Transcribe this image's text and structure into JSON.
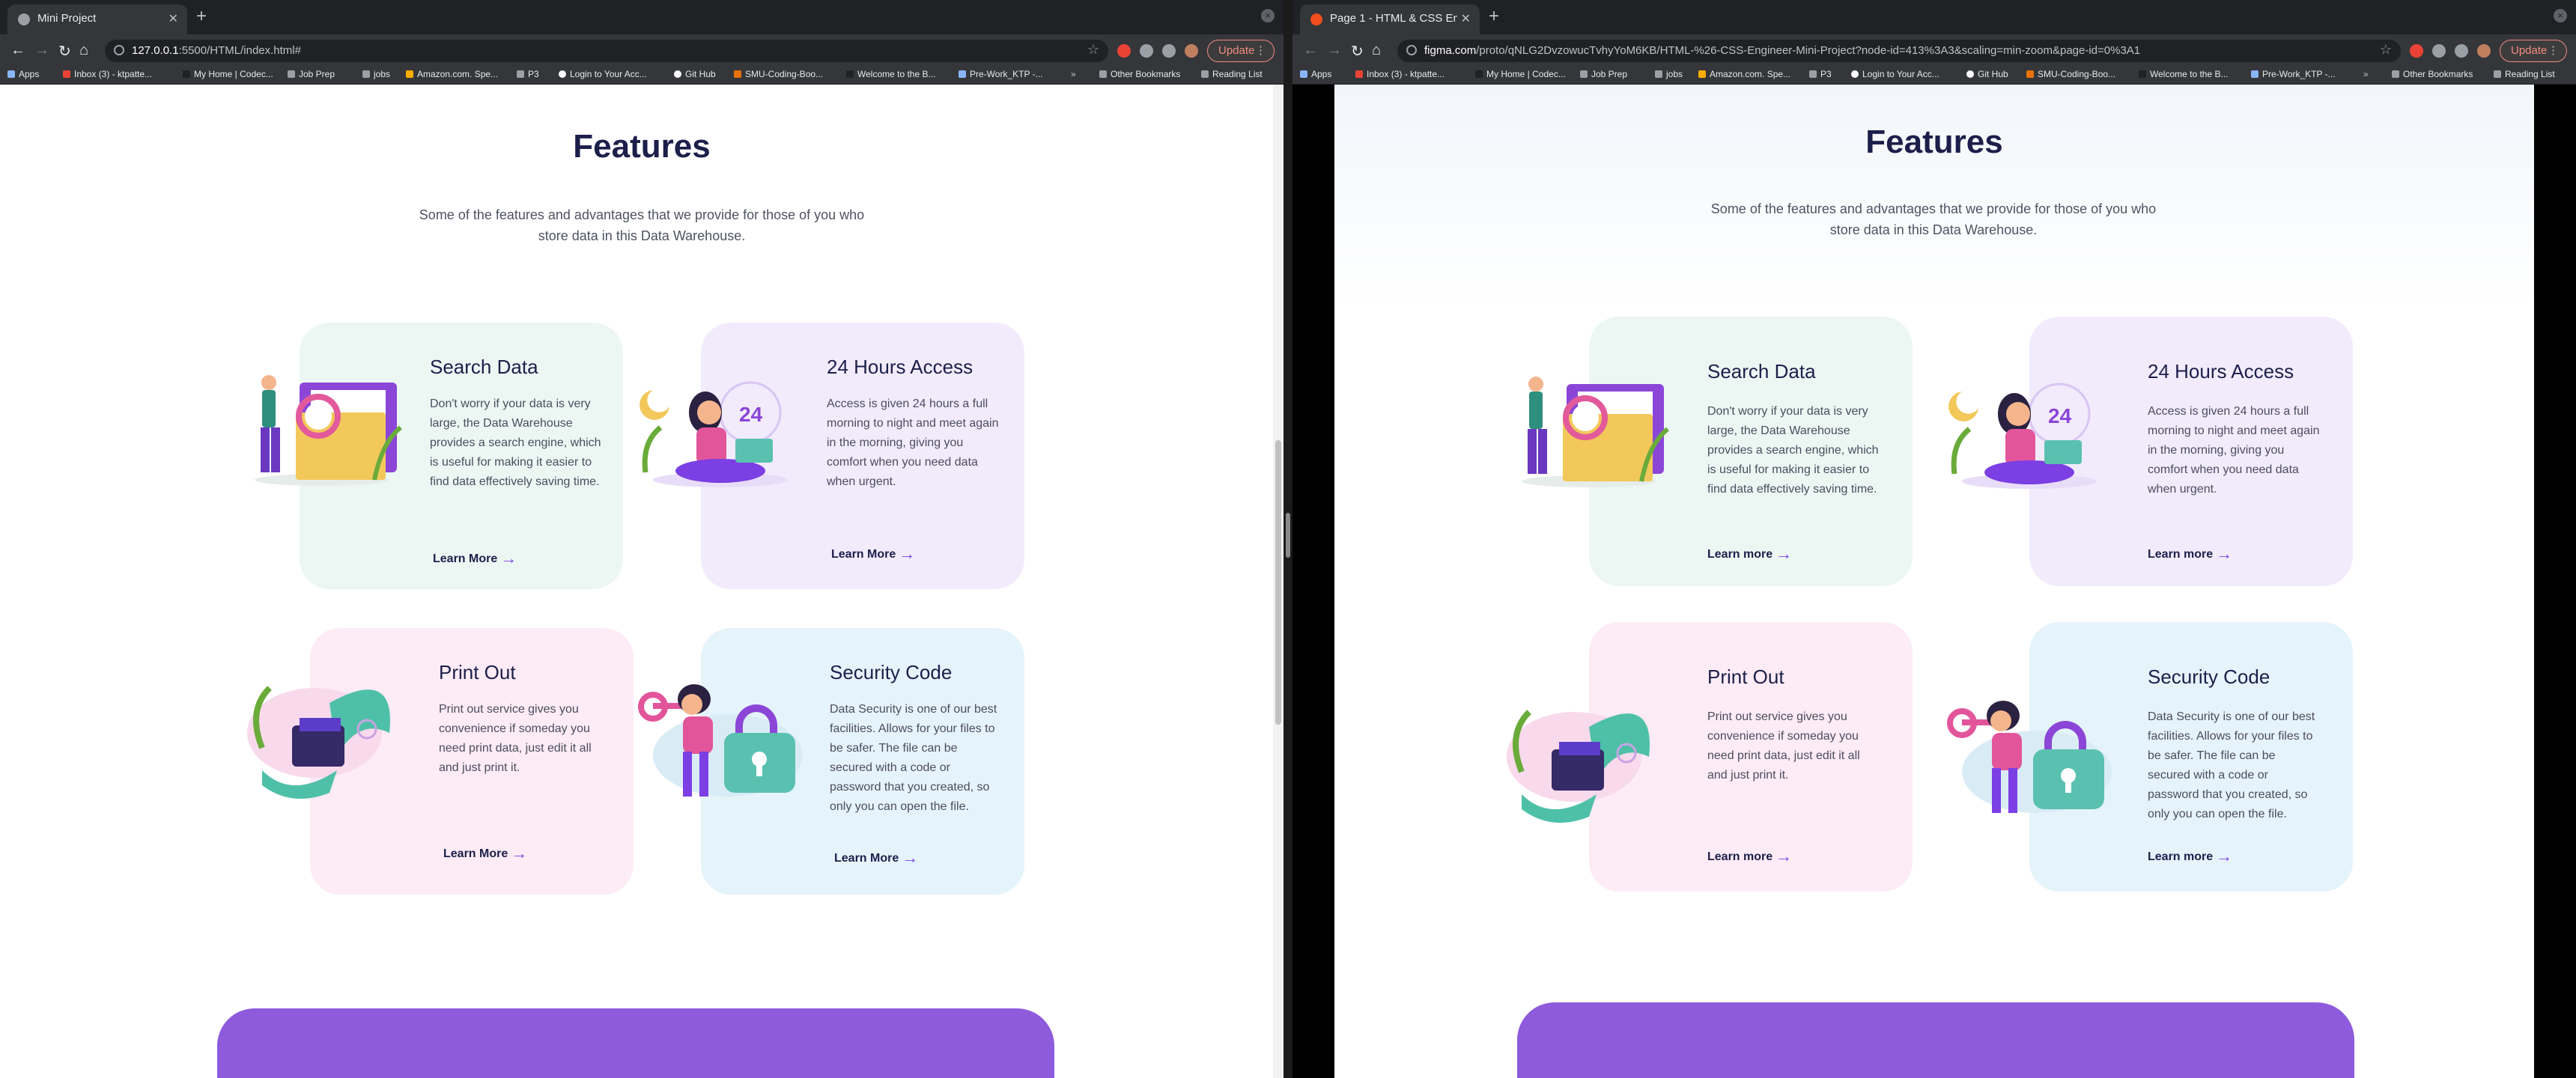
{
  "left": {
    "tab_title": "Mini Project",
    "url_host": "127.0.0.1",
    "url_rest": ":5500/HTML/index.html#",
    "update_label": "Update",
    "page": {
      "heading": "Features",
      "subtitle": "Some of the features and advantages that we provide for those of you who store data in this Data Warehouse."
    }
  },
  "right": {
    "tab_title": "Page 1 - HTML & CSS Engi",
    "url_host": "figma.com",
    "url_rest": "/proto/qNLG2DvzowucTvhyYoM6KB/HTML-%26-CSS-Engineer-Mini-Project?node-id=413%3A3&scaling=min-zoom&page-id=0%3A1",
    "update_label": "Update",
    "page": {
      "heading": "Features",
      "subtitle": "Some of the features and advantages that we provide for those of you who store data in this Data Warehouse."
    }
  },
  "bookmarks": [
    "Apps",
    "Inbox (3) - ktpatte...",
    "My Home | Codec...",
    "Job Prep",
    "jobs",
    "Amazon.com. Spe...",
    "P3",
    "Login to Your Acc...",
    "Git Hub",
    "SMU-Coding-Boo...",
    "Welcome to the B...",
    "Pre-Work_KTP -...",
    "Other Bookmarks",
    "Reading List"
  ],
  "cards": [
    {
      "title": "Search Data",
      "text": "Don't worry if your data is very large, the Data Warehouse provides a search engine, which is useful for making it easier to find data effectively saving time.",
      "link_left": "Learn More",
      "link_right": "Learn more",
      "bg": "#ecf7f4",
      "icon": "search-data-illustration"
    },
    {
      "title": "24 Hours Access",
      "text": "Access is given 24 hours a full morning to night and meet again in the morning, giving you comfort when you need data when urgent.",
      "link_left": "Learn More",
      "link_right": "Learn more",
      "bg": "#f2ebfc",
      "icon": "24-hours-illustration",
      "badge": "24"
    },
    {
      "title": "Print Out",
      "text": "Print out service gives you convenience if someday you need print data, just edit it all and just print it.",
      "link_left": "Learn More",
      "link_right": "Learn more",
      "bg": "#fdebf5",
      "icon": "print-out-illustration"
    },
    {
      "title": "Security Code",
      "text": "Data Security is one of our best facilities. Allows for your files to be safer. The file can be secured with a code or password that you created, so only you can open the file.",
      "link_left": "Learn More",
      "link_right": "Learn more",
      "bg": "#e5f3fb",
      "icon": "security-code-illustration"
    }
  ],
  "colors": {
    "heading": "#1c1f4a",
    "accent": "#7b3fe4",
    "banner": "#8e5bdc"
  }
}
